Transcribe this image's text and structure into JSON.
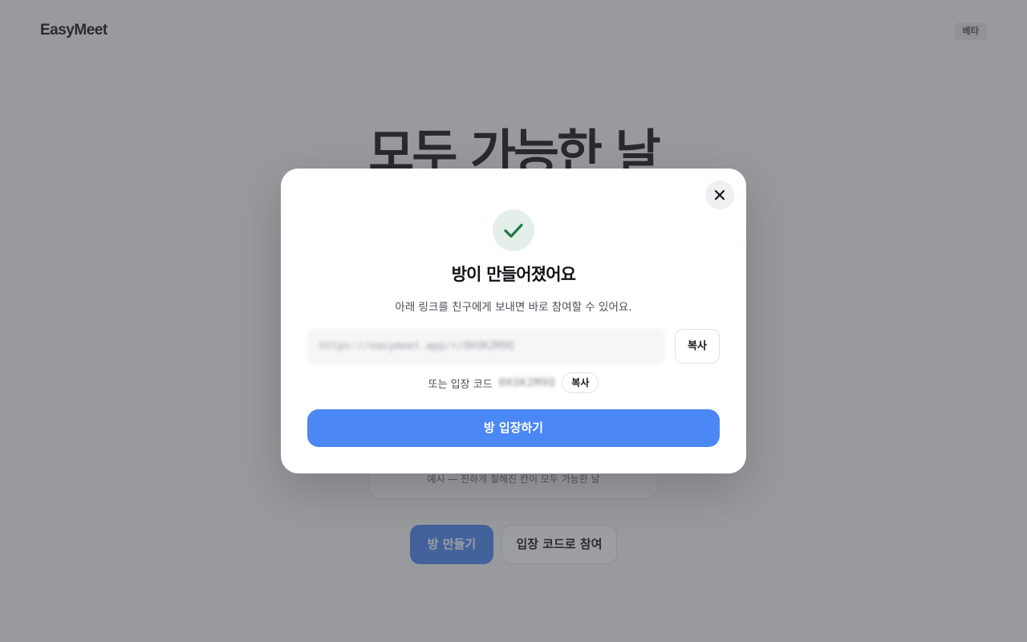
{
  "header": {
    "brand": "EasyMeet",
    "badge": "베타"
  },
  "hero": {
    "title": "모두 가능한 날"
  },
  "preview": {
    "caption": "예시 — 진하게 칠해진 칸이 모두 가능한 날"
  },
  "actions": {
    "create_label": "방 만들기",
    "join_label": "입장 코드로 참여"
  },
  "modal": {
    "title": "방이 만들어졌어요",
    "description": "아래 링크를 친구에게 보내면 바로 참여할 수 있어요.",
    "link_value": "https://easymeet.app/r/8H3K2M9Q",
    "copy_link_label": "복사",
    "code_label": "또는 입장 코드",
    "code_value": "8H3K2M9Q",
    "copy_code_label": "복사",
    "enter_label": "방 입장하기"
  },
  "icons": {
    "close": "close-icon",
    "success": "check-icon"
  },
  "colors": {
    "primary": "#4b87f5",
    "success": "#1f7a45",
    "success_bg": "#e3efe8"
  }
}
